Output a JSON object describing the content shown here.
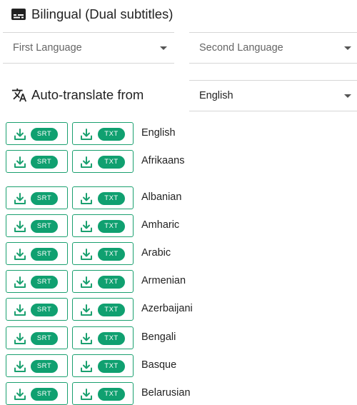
{
  "header": {
    "title": "Bilingual (Dual subtitles)",
    "icon": "subtitles-icon"
  },
  "selects": {
    "first_language": {
      "placeholder": "First Language"
    },
    "second_language": {
      "placeholder": "Second Language"
    },
    "auto_translate_value": "English"
  },
  "auto_translate": {
    "label": "Auto-translate from",
    "icon": "translate-icon"
  },
  "buttons": {
    "srt_label": "SRT",
    "txt_label": "TXT",
    "icon": "download-icon"
  },
  "languages": [
    "English",
    "Afrikaans",
    "Albanian",
    "Amharic",
    "Arabic",
    "Armenian",
    "Azerbaijani",
    "Bengali",
    "Basque",
    "Belarusian"
  ],
  "colors": {
    "accent": "#10a070",
    "border": "#1aa06f",
    "text": "#222222",
    "placeholder": "#666666"
  }
}
